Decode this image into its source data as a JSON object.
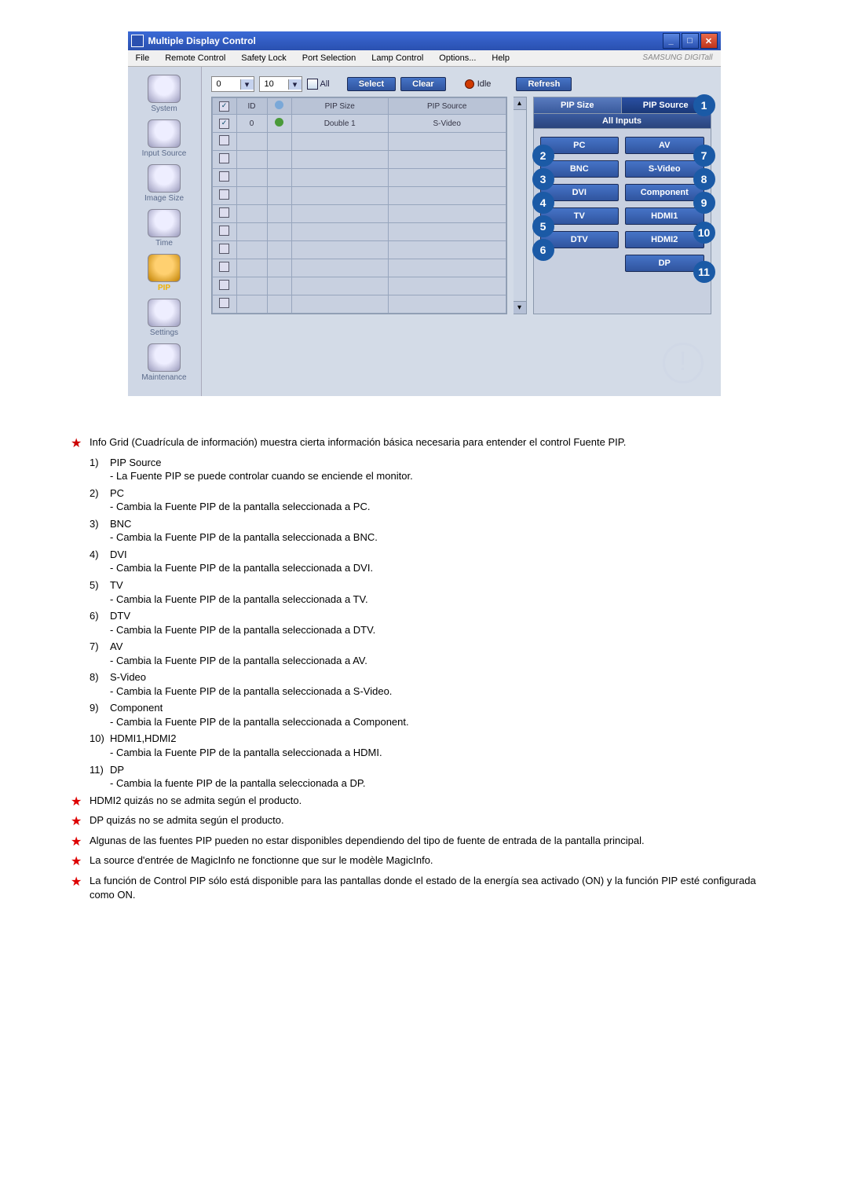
{
  "window": {
    "title": "Multiple Display Control",
    "menus": [
      "File",
      "Remote Control",
      "Safety Lock",
      "Port Selection",
      "Lamp Control",
      "Options...",
      "Help"
    ],
    "brand": "SAMSUNG DIGITall"
  },
  "sidebar": [
    {
      "label": "System"
    },
    {
      "label": "Input Source"
    },
    {
      "label": "Image Size"
    },
    {
      "label": "Time"
    },
    {
      "label": "PIP",
      "selected": true
    },
    {
      "label": "Settings"
    },
    {
      "label": "Maintenance"
    }
  ],
  "toolbar": {
    "combo1": "0",
    "combo2": "10",
    "all": "All",
    "select": "Select",
    "clear": "Clear",
    "idle": "Idle",
    "refresh": "Refresh"
  },
  "grid": {
    "headers": [
      "",
      "ID",
      "",
      "PIP Size",
      "PIP Source"
    ],
    "row": {
      "id": "0",
      "size": "Double 1",
      "source": "S-Video"
    }
  },
  "panel": {
    "tab1": "PIP Size",
    "tab2": "PIP Source",
    "allInputs": "All Inputs",
    "left": [
      "PC",
      "BNC",
      "DVI",
      "TV",
      "DTV"
    ],
    "right": [
      "AV",
      "S-Video",
      "Component",
      "HDMI1",
      "HDMI2",
      "DP"
    ]
  },
  "callouts": {
    "c1": "1",
    "c2": "2",
    "c3": "3",
    "c4": "4",
    "c5": "5",
    "c6": "6",
    "c7": "7",
    "c8": "8",
    "c9": "9",
    "c10": "10",
    "c11": "11"
  },
  "intro": "Info Grid (Cuadrícula de información) muestra cierta información básica necesaria para entender el control Fuente PIP.",
  "list": [
    {
      "n": "1)",
      "t": "PIP Source",
      "d": "- La Fuente PIP se puede controlar cuando se enciende el monitor."
    },
    {
      "n": "2)",
      "t": "PC",
      "d": "- Cambia la Fuente PIP de la pantalla seleccionada a PC."
    },
    {
      "n": "3)",
      "t": "BNC",
      "d": "- Cambia la Fuente PIP de la pantalla seleccionada a BNC."
    },
    {
      "n": "4)",
      "t": "DVI",
      "d": "- Cambia la Fuente PIP de la pantalla seleccionada a DVI."
    },
    {
      "n": "5)",
      "t": "TV",
      "d": "- Cambia la Fuente PIP de la pantalla seleccionada a TV."
    },
    {
      "n": "6)",
      "t": "DTV",
      "d": "- Cambia la Fuente PIP de la pantalla seleccionada a DTV."
    },
    {
      "n": "7)",
      "t": "AV",
      "d": "- Cambia la Fuente PIP de la pantalla seleccionada a AV."
    },
    {
      "n": "8)",
      "t": "S-Video",
      "d": "- Cambia la Fuente PIP de la pantalla seleccionada a S-Video."
    },
    {
      "n": "9)",
      "t": "Component",
      "d": "- Cambia la Fuente PIP de la pantalla seleccionada a Component."
    },
    {
      "n": "10)",
      "t": "HDMI1,HDMI2",
      "d": "- Cambia la Fuente PIP de la pantalla seleccionada a HDMI."
    },
    {
      "n": "11)",
      "t": "DP",
      "d": "- Cambia la fuente PIP de la pantalla seleccionada a DP."
    }
  ],
  "notes": [
    "HDMI2 quizás no se admita según el producto.",
    "DP quizás no se admita según el producto.",
    "Algunas de las fuentes PIP pueden no estar disponibles dependiendo del tipo de fuente de entrada de la pantalla principal.",
    "La source d'entrée de MagicInfo ne fonctionne que sur le modèle MagicInfo.",
    "La función de Control PIP sólo está disponible para las pantallas donde el estado de la energía sea activado (ON) y la función PIP esté configurada como ON."
  ]
}
